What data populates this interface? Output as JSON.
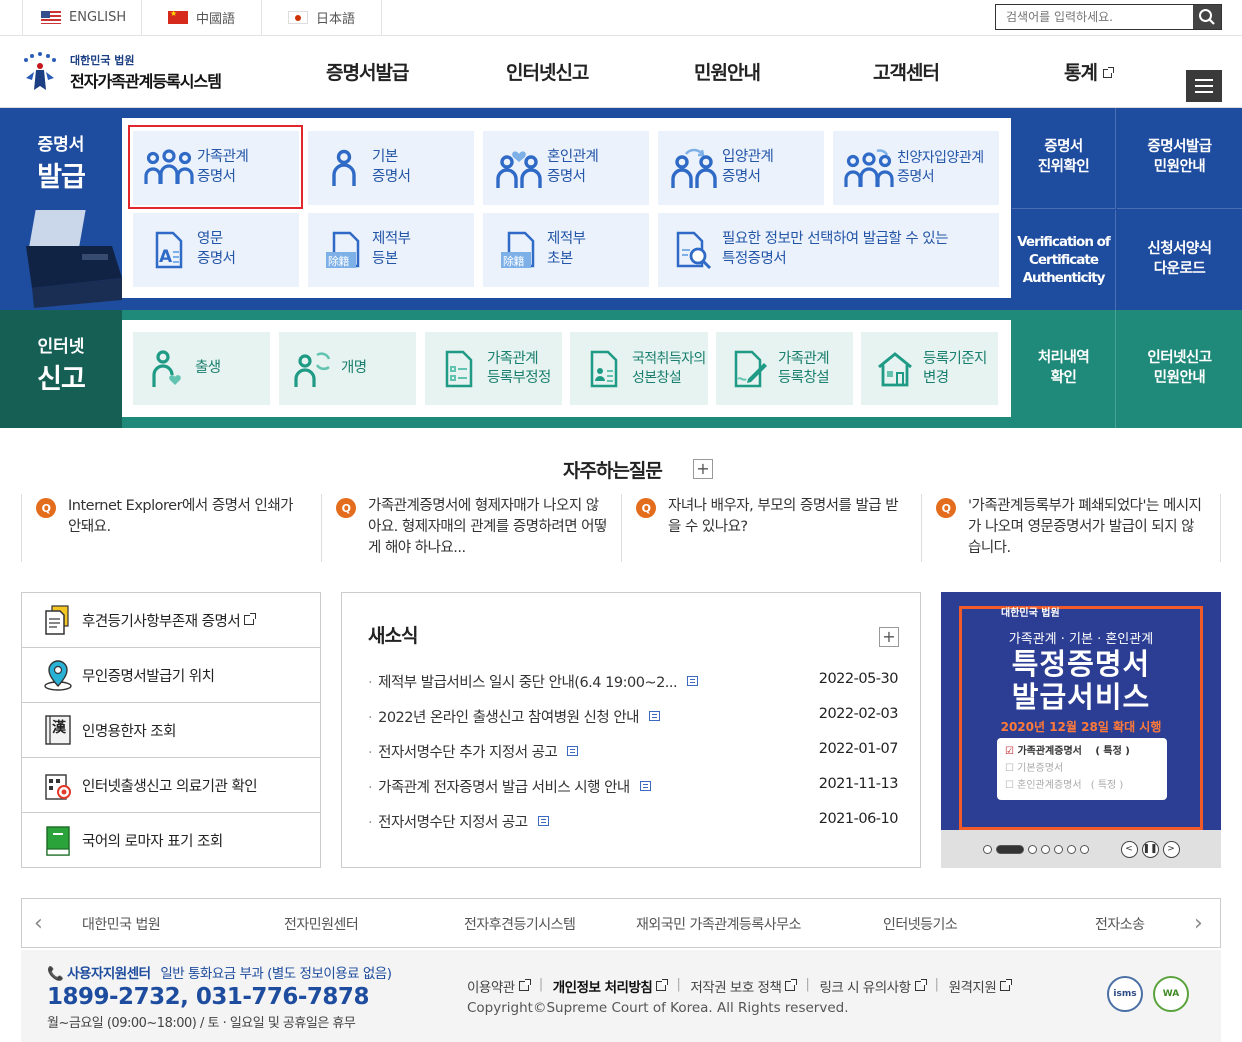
{
  "languages": [
    {
      "label": "ENGLISH",
      "flag": "us-flag-icon"
    },
    {
      "label": "中國語",
      "flag": "cn-flag-icon"
    },
    {
      "label": "日本語",
      "flag": "jp-flag-icon"
    }
  ],
  "search": {
    "placeholder": "검색어를 입력하세요."
  },
  "logo": {
    "line1": "대한민국 법원",
    "line2": "전자가족관계등록시스템"
  },
  "gnb": [
    "증명서발급",
    "인터넷신고",
    "민원안내",
    "고객센터",
    "통계"
  ],
  "cert_section": {
    "label_small": "증명서",
    "label_big": "발급",
    "items": [
      {
        "label": "가족관계\n증명서",
        "icon": "family-icon"
      },
      {
        "label": "기본\n증명서",
        "icon": "person-icon"
      },
      {
        "label": "혼인관계\n증명서",
        "icon": "couple-heart-icon"
      },
      {
        "label": "입양관계\n증명서",
        "icon": "adoption-icon"
      },
      {
        "label": "친양자입양관계\n증명서",
        "icon": "full-adoption-icon"
      },
      {
        "label": "영문\n증명서",
        "icon": "english-doc-icon"
      },
      {
        "label": "제적부\n등본",
        "icon": "removed-register-icon"
      },
      {
        "label": "제적부\n초본",
        "icon": "removed-register-icon"
      },
      {
        "label": "필요한 정보만 선택하여 발급할 수 있는\n특정증명서",
        "icon": "doc-search-icon"
      }
    ],
    "side": [
      "증명서\n진위확인",
      "증명서발급\n민원안내",
      "Verification of\nCertificate\nAuthenticity",
      "신청서양식\n다운로드"
    ]
  },
  "report_section": {
    "label_small": "인터넷",
    "label_big": "신고",
    "items": [
      {
        "label": "출생",
        "icon": "birth-icon"
      },
      {
        "label": "개명",
        "icon": "rename-icon"
      },
      {
        "label": "가족관계\n등록부정정",
        "icon": "correction-icon"
      },
      {
        "label": "국적취득자의\n성본창설",
        "icon": "nationality-icon"
      },
      {
        "label": "가족관계\n등록창설",
        "icon": "create-register-icon"
      },
      {
        "label": "등록기준지\n변경",
        "icon": "house-icon"
      }
    ],
    "side": [
      "처리내역\n확인",
      "인터넷신고\n민원안내"
    ]
  },
  "faq": {
    "title": "자주하는질문",
    "items": [
      "Internet Explorer에서 증명서 인쇄가 안돼요.",
      "가족관계증명서에 형제자매가 나오지 않아요. 형제자매의 관계를 증명하려면 어떻게 해야 하나요...",
      "자녀나 배우자, 부모의 증명서를 발급 받을 수 있나요?",
      "'가족관계등록부가 폐쇄되었다'는 메시지가 나오며 영문증명서가 발급이 되지 않습니다."
    ]
  },
  "quick": [
    {
      "label": "후견등기사항부존재 증명서",
      "icon": "guardian-doc-icon",
      "external": true
    },
    {
      "label": "무인증명서발급기 위치",
      "icon": "location-pin-icon",
      "external": false
    },
    {
      "label": "인명용한자 조회",
      "icon": "hanja-book-icon",
      "external": false
    },
    {
      "label": "인터넷출생신고 의료기관 확인",
      "icon": "hospital-icon",
      "external": false
    },
    {
      "label": "국어의 로마자 표기 조회",
      "icon": "green-book-icon",
      "external": false
    }
  ],
  "news": {
    "title": "새소식",
    "items": [
      {
        "title": "제적부 발급서비스 일시 중단 안내(6.4 19:00~2...",
        "date": "2022-05-30"
      },
      {
        "title": "2022년 온라인 출생신고 참여병원 신청 안내",
        "date": "2022-02-03"
      },
      {
        "title": "전자서명수단 추가 지정서 공고",
        "date": "2022-01-07"
      },
      {
        "title": "가족관계 전자증명서 발급 서비스 시행 안내",
        "date": "2021-11-13"
      },
      {
        "title": "전자서명수단 지정서 공고",
        "date": "2021-06-10"
      }
    ]
  },
  "banner": {
    "court": "대한민국 법원",
    "line1": "가족관계 · 기본 · 혼인관계",
    "line2": "특정증명서",
    "line3": "발급서비스",
    "line4": "2020년 12월 28일 확대 시행",
    "card": [
      "가족관계증명서",
      "기본증명서",
      "혼인관계증명서"
    ],
    "card_tag": "( 특정 )",
    "card_tag_faded": "( 특정 )"
  },
  "sites": [
    "대한민국 법원",
    "전자민원센터",
    "전자후견등기시스템",
    "재외국민 가족관계등록사무소",
    "인터넷등기소",
    "전자소송"
  ],
  "footer": {
    "center_title": "사용자지원센터",
    "center_note": "일반 통화요금 부과 (별도 정보이용료 없음)",
    "phone": "1899-2732, 031-776-7878",
    "hours": "월~금요일 (09:00~18:00) / 토 · 일요일 및 공휴일은 휴무",
    "links": [
      "이용약관",
      "개인정보 처리방침",
      "저작권 보호 정책",
      "링크 시 유의사항",
      "원격지원"
    ],
    "copyright": "Copyright©Supreme Court of Korea. All Rights reserved.",
    "badges": [
      "isms",
      "WA"
    ]
  },
  "colors": {
    "blue": "#1e4c9e",
    "green": "#1f8a7a",
    "highlight": "#e1262c",
    "faq_q": "#e36c1d",
    "banner_bg": "#2c3e93",
    "banner_accent": "#f15a29"
  }
}
